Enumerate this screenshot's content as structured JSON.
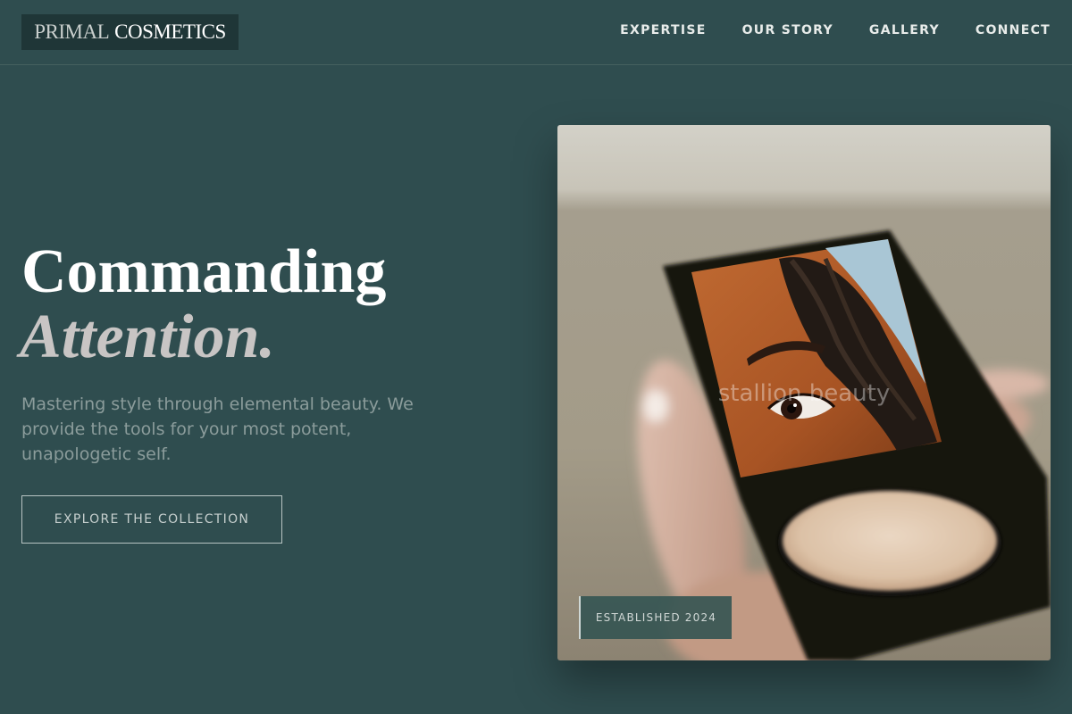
{
  "brand": {
    "logo_part1": "PRIMAL",
    "logo_part2": "COSMETICS"
  },
  "nav": {
    "items": [
      {
        "label": "EXPERTISE"
      },
      {
        "label": "OUR STORY"
      },
      {
        "label": "GALLERY"
      },
      {
        "label": "CONNECT"
      }
    ]
  },
  "hero": {
    "title_line1": "Commanding",
    "title_line2": "Attention.",
    "subtitle": "Mastering style through elemental beauty. We provide the tools for your most potent, unapologetic self.",
    "cta_label": "EXPLORE THE COLLECTION"
  },
  "photo": {
    "watermark": "stallion beauty",
    "badge": "ESTABLISHED 2024"
  },
  "colors": {
    "background": "#2f4d4f",
    "logo_bg": "#1f3637",
    "accent_text": "#c8c5c4",
    "muted_text": "#8b9c9b"
  }
}
